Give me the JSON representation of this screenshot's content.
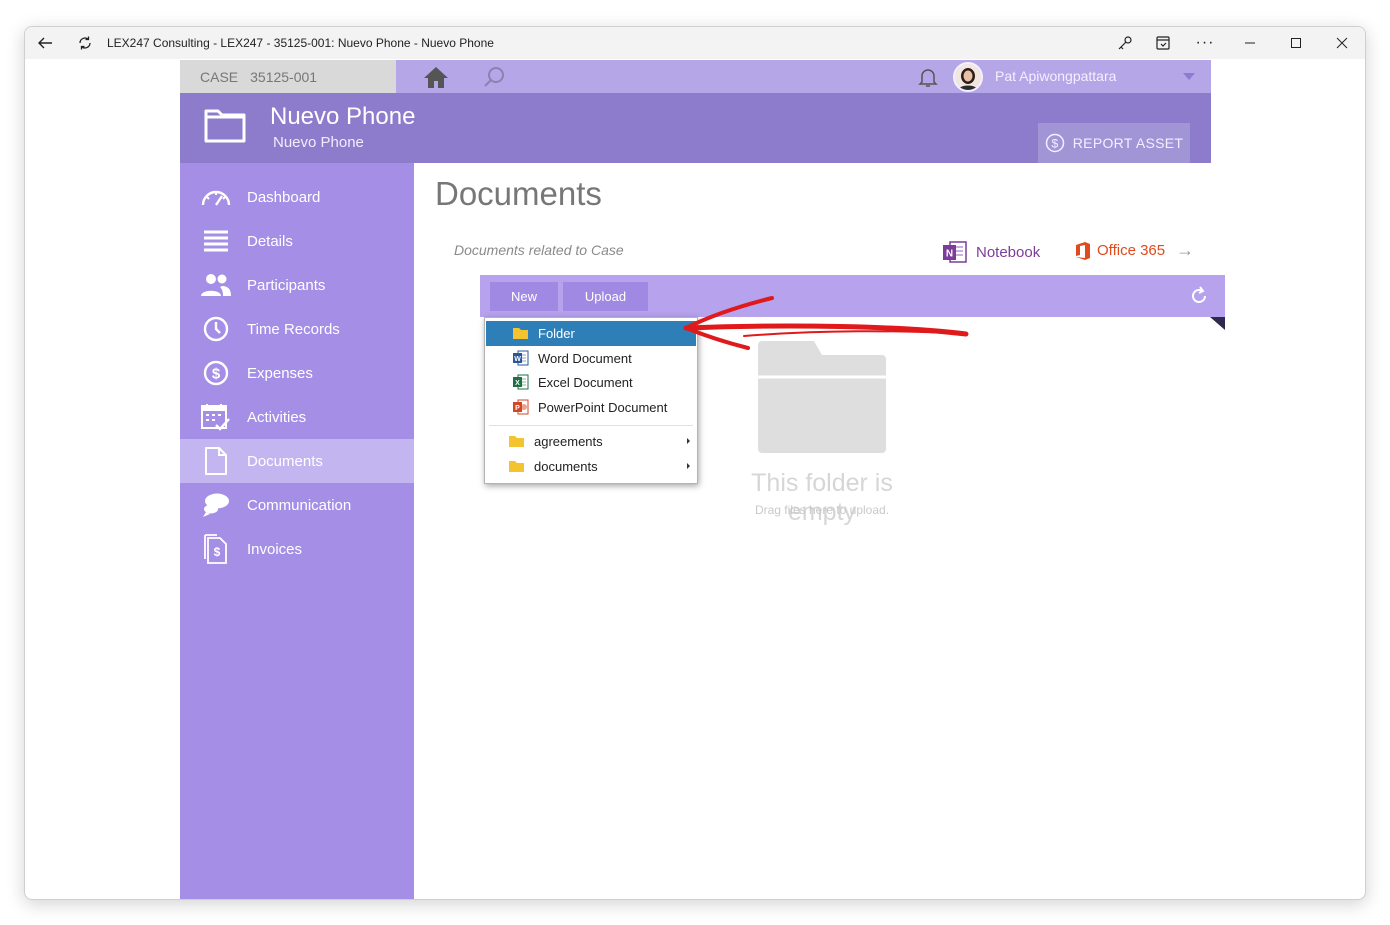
{
  "window": {
    "title": "LEX247 Consulting - LEX247 - 35125-001: Nuevo Phone - Nuevo Phone"
  },
  "topnav": {
    "case_label": "CASE",
    "case_number": "35125-001",
    "user_name": "Pat Apiwongpattara"
  },
  "header": {
    "title": "Nuevo Phone",
    "subtitle": "Nuevo Phone",
    "report_label": "REPORT ASSET"
  },
  "sidebar": {
    "items": [
      {
        "label": "Dashboard",
        "icon": "dashboard-icon"
      },
      {
        "label": "Details",
        "icon": "details-icon"
      },
      {
        "label": "Participants",
        "icon": "participants-icon"
      },
      {
        "label": "Time Records",
        "icon": "clock-icon"
      },
      {
        "label": "Expenses",
        "icon": "dollar-icon"
      },
      {
        "label": "Activities",
        "icon": "calendar-icon"
      },
      {
        "label": "Documents",
        "icon": "document-icon",
        "active": true
      },
      {
        "label": "Communication",
        "icon": "chat-icon"
      },
      {
        "label": "Invoices",
        "icon": "invoice-icon"
      }
    ]
  },
  "main": {
    "title": "Documents",
    "related": "Documents related to Case",
    "notebook_label": "Notebook",
    "office_label": "Office 365",
    "toolbar": {
      "new_label": "New",
      "upload_label": "Upload"
    },
    "empty": {
      "title": "This folder is empty",
      "subtitle": "Drag files here to upload."
    }
  },
  "new_menu": {
    "items": [
      {
        "label": "Folder",
        "icon": "folder-icon",
        "selected": true
      },
      {
        "label": "Word Document",
        "icon": "word-icon"
      },
      {
        "label": "Excel Document",
        "icon": "excel-icon"
      },
      {
        "label": "PowerPoint Document",
        "icon": "powerpoint-icon"
      }
    ],
    "templates": [
      {
        "label": "agreements",
        "icon": "folder-icon"
      },
      {
        "label": "documents",
        "icon": "folder-icon"
      }
    ]
  },
  "colors": {
    "header": "#8c7ccb",
    "sidebar": "#a48ee6",
    "toolbar": "#b6a2ed",
    "selected_menu": "#2e7fb8",
    "annotation_arrow": "#e0191b"
  }
}
